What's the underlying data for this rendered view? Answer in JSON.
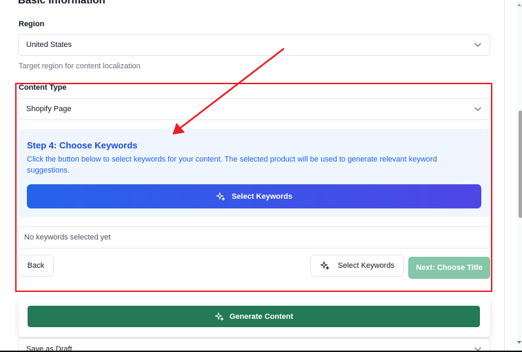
{
  "section": {
    "title": "Basic Information"
  },
  "region": {
    "label": "Region",
    "value": "United States",
    "hint": "Target region for content localization"
  },
  "content_type": {
    "label": "Content Type",
    "value": "Shopify Page"
  },
  "step": {
    "title": "Step 4: Choose Keywords",
    "description": "Click the button below to select keywords for your content. The selected product will be used to generate relevant keyword suggestions.",
    "button_label": "Select Keywords"
  },
  "keywords": {
    "empty_text": "No keywords selected yet"
  },
  "nav": {
    "back_label": "Back",
    "select_keywords_label": "Select Keywords",
    "next_label": "Next: Choose Title"
  },
  "generate": {
    "button_label": "Generate Content"
  },
  "save": {
    "value": "Save as Draft"
  },
  "colors": {
    "annotation_red": "#ee1c25",
    "primary_blue": "#2563eb",
    "primary_indigo": "#4f46e5",
    "generate_green": "#237a55",
    "next_disabled_green": "#86c6aa",
    "step_bg": "#eff6ff"
  },
  "icons": {
    "chevron": "chevron-down-icon",
    "sparkles": "sparkles-icon",
    "annotation_arrow": "arrow-annotation"
  }
}
